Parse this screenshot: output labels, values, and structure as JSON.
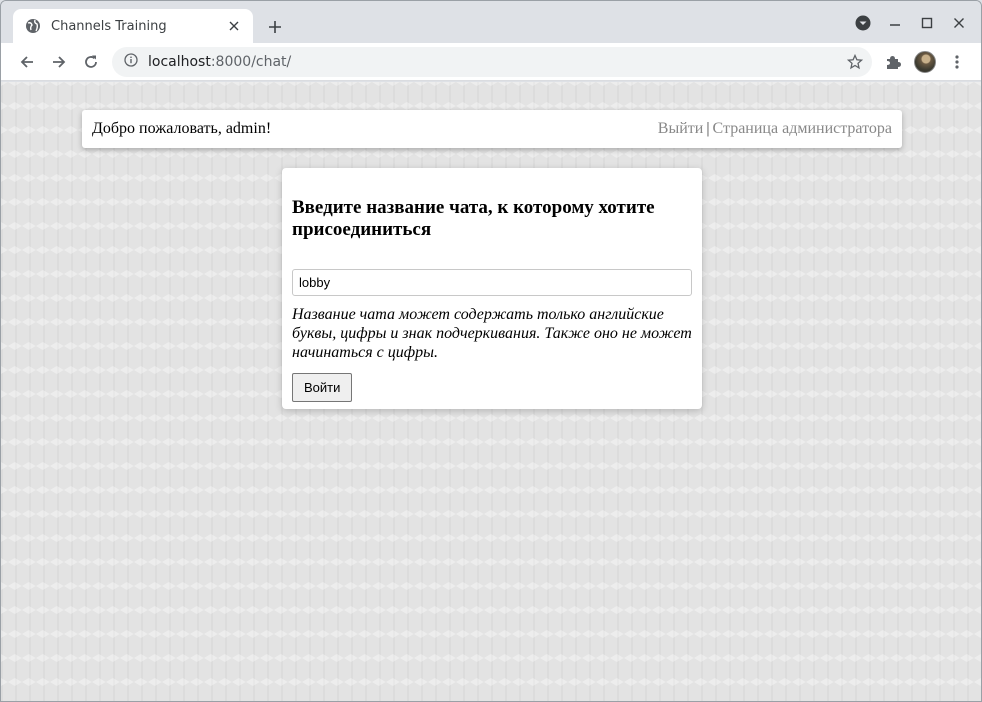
{
  "browser": {
    "tab_title": "Channels Training",
    "url_host": "localhost",
    "url_rest": ":8000/chat/"
  },
  "icons": {
    "favicon": "globe-icon",
    "tab_close": "close-icon",
    "new_tab": "plus-icon",
    "tab_search": "chevron-down-circle-icon",
    "minimize": "minimize-icon",
    "maximize": "maximize-icon",
    "close_window": "close-icon",
    "back": "arrow-left-icon",
    "forward": "arrow-right-icon",
    "reload": "reload-icon",
    "site_info": "info-icon",
    "bookmark": "star-icon",
    "extensions": "puzzle-icon",
    "menu": "more-vertical-icon"
  },
  "header": {
    "welcome": "Добро пожаловать, admin!",
    "logout": "Выйти",
    "separator": "|",
    "admin_page": "Страница администратора"
  },
  "room_form": {
    "heading": "Введите название чата, к которому хотите присоединиться",
    "input_value": "lobby",
    "hint": "Название чата может содержать только английские буквы, цифры и знак подчеркивания. Также оно не может начинаться с цифры.",
    "submit_label": "Войти"
  }
}
